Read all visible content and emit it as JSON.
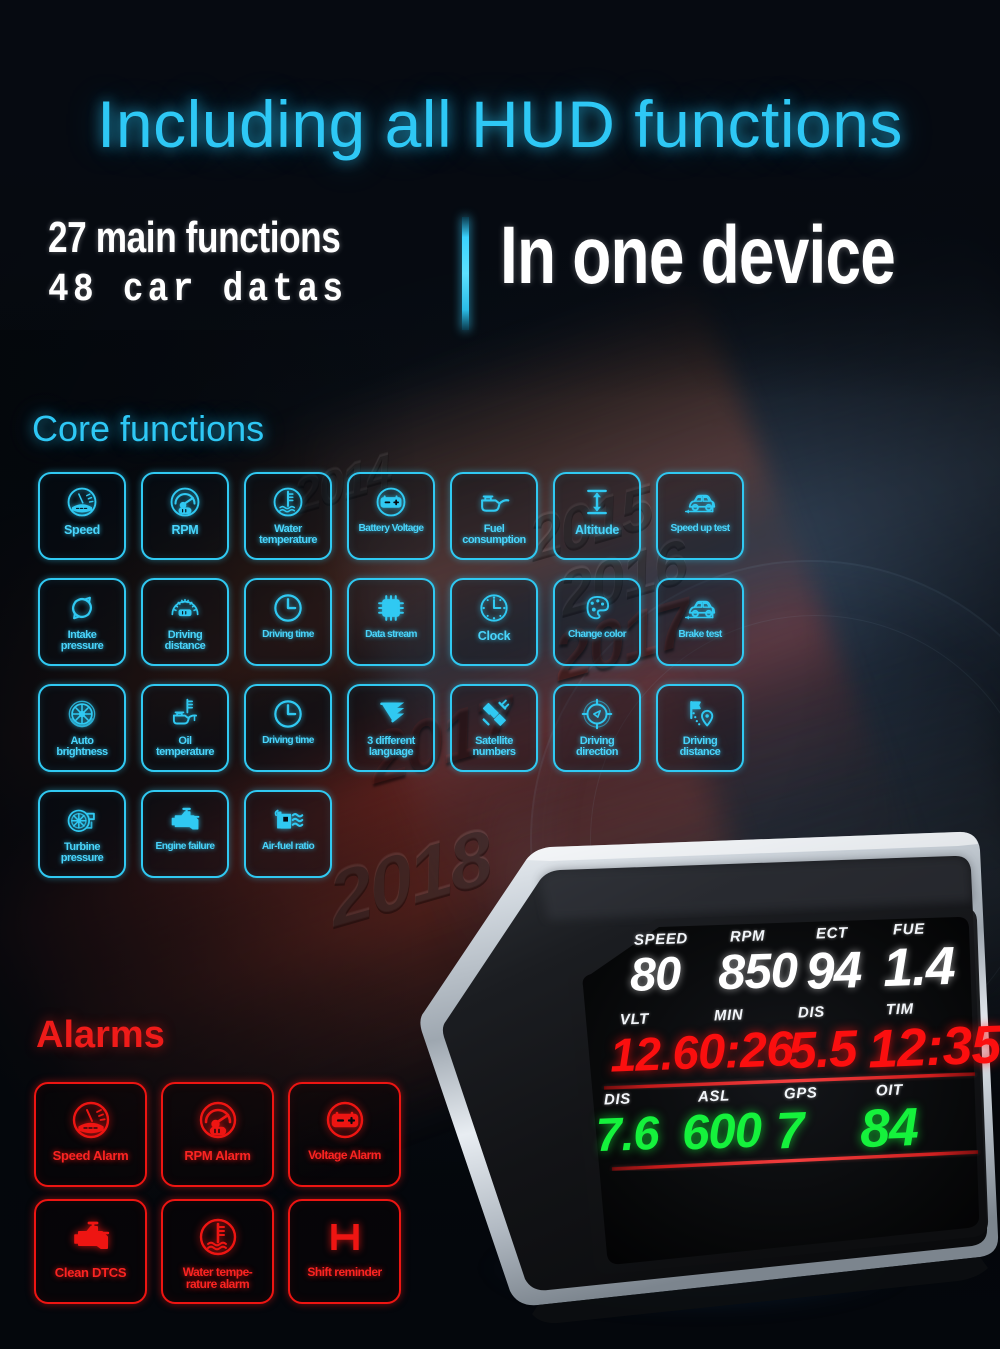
{
  "headline": "Including all HUD functions",
  "subhead": {
    "line1": "27 main functions",
    "line2": "48  car  datas",
    "right": "In one device"
  },
  "sections": {
    "core_title": "Core functions",
    "alarms_title": "Alarms"
  },
  "colors": {
    "cyan": "#30c9f2",
    "cyan_text": "#49d4fb",
    "red": "#ee1512",
    "red_text": "#fb2422",
    "hud_white": "#ffffff",
    "hud_red": "#fb0f0f",
    "hud_green": "#15f23c",
    "background": "#06090f"
  },
  "core_functions": [
    {
      "label": "Speed",
      "icon": "speedometer-icon",
      "size": ""
    },
    {
      "label": "RPM",
      "icon": "tachometer-icon",
      "size": ""
    },
    {
      "label": "Water\ntemperature",
      "icon": "coolant-temp-icon",
      "size": "sm"
    },
    {
      "label": "Battery Voltage",
      "icon": "battery-icon",
      "size": "xs"
    },
    {
      "label": "Fuel\nconsumption",
      "icon": "oil-can-icon",
      "size": "sm"
    },
    {
      "label": "Altitude",
      "icon": "height-arrow-icon",
      "size": ""
    },
    {
      "label": "Speed up test",
      "icon": "car-accelerate-icon",
      "size": "xs"
    },
    {
      "label": "Intake\npressure",
      "icon": "recycle-arrows-icon",
      "size": "sm"
    },
    {
      "label": "Driving\ndistance",
      "icon": "odometer-icon",
      "size": "sm"
    },
    {
      "label": "Driving time",
      "icon": "clock-icon",
      "size": "xs"
    },
    {
      "label": "Data stream",
      "icon": "chip-icon",
      "size": "xs"
    },
    {
      "label": "Clock",
      "icon": "clock-dots-icon",
      "size": ""
    },
    {
      "label": "Change color",
      "icon": "palette-icon",
      "size": "xs"
    },
    {
      "label": "Brake test",
      "icon": "car-brake-icon",
      "size": "xs"
    },
    {
      "label": "Auto\nbrightness",
      "icon": "turbine-fan-icon",
      "size": "sm"
    },
    {
      "label": "Oil\ntemperature",
      "icon": "oil-temp-icon",
      "size": "sm"
    },
    {
      "label": "Driving time",
      "icon": "clock-icon",
      "size": "xs"
    },
    {
      "label": "3 different\nlanguage",
      "icon": "three-glyph-icon",
      "size": "sm"
    },
    {
      "label": "Satellite\nnumbers",
      "icon": "satellite-icon",
      "size": "sm"
    },
    {
      "label": "Driving\ndirection",
      "icon": "compass-icon",
      "size": "sm"
    },
    {
      "label": "Driving\ndistance",
      "icon": "flag-pin-icon",
      "size": "sm"
    },
    {
      "label": "Turbine\npressure",
      "icon": "turbo-icon",
      "size": "sm"
    },
    {
      "label": "Engine failure",
      "icon": "engine-icon",
      "size": "xs"
    },
    {
      "label": "Air-fuel ratio",
      "icon": "fuel-pump-wave-icon",
      "size": "xs"
    }
  ],
  "alarms": [
    {
      "label": "Speed Alarm",
      "icon": "speedometer-icon",
      "size": ""
    },
    {
      "label": "RPM Alarm",
      "icon": "tachometer-icon",
      "size": ""
    },
    {
      "label": "Voltage Alarm",
      "icon": "battery-icon",
      "size": "sm"
    },
    {
      "label": "Clean DTCS",
      "icon": "engine-icon",
      "size": ""
    },
    {
      "label": "Water tempe-\nrature alarm",
      "icon": "coolant-temp-icon",
      "size": "sm"
    },
    {
      "label": "Shift reminder",
      "icon": "shift-gear-icon",
      "size": "sm"
    }
  ],
  "hud_display": {
    "rows": [
      {
        "color_key": "hud_white",
        "cells": [
          {
            "label": "SPEED",
            "value": "80"
          },
          {
            "label": "RPM",
            "value": "850"
          },
          {
            "label": "ECT",
            "value": "94"
          },
          {
            "label": "FUE",
            "value": "1.4"
          }
        ]
      },
      {
        "color_key": "hud_red",
        "cells": [
          {
            "label": "VLT",
            "value": "12.6"
          },
          {
            "label": "MIN",
            "value": "0:26"
          },
          {
            "label": "DIS",
            "value": "5.5"
          },
          {
            "label": "TIM",
            "value": "12:35"
          }
        ]
      },
      {
        "color_key": "hud_green",
        "cells": [
          {
            "label": "DIS",
            "value": "7.6"
          },
          {
            "label": "ASL",
            "value": "600"
          },
          {
            "label": "GPS",
            "value": "7"
          },
          {
            "label": "OIT",
            "value": "84"
          }
        ]
      }
    ]
  }
}
